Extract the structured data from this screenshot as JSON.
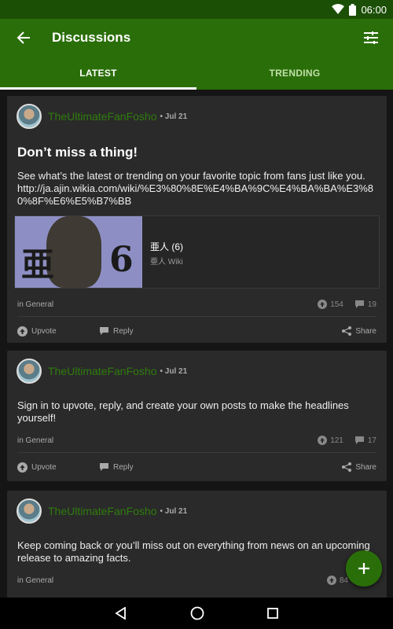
{
  "status": {
    "time": "06:00"
  },
  "appbar": {
    "title": "Discussions"
  },
  "tabs": [
    {
      "label": "LATEST"
    },
    {
      "label": "TRENDING"
    }
  ],
  "posts": [
    {
      "author": "TheUltimateFanFosho",
      "date": "• Jul 21",
      "title": "Don’t miss a thing!",
      "body": "See what’s the latest or trending on your favorite topic from fans just like you. http://ja.ajin.wikia.com/wiki/%E3%80%8E%E4%BA%9C%E4%BA%BA%E3%80%8F%E6%E5%B7%BB",
      "preview": {
        "title": "亜人 (6)",
        "site": "亜人 Wiki",
        "thumb_glyph_1": "亜",
        "thumb_glyph_2": "6"
      },
      "category": "in General",
      "upvotes": "154",
      "replies": "19",
      "actions": {
        "upvote": "Upvote",
        "reply": "Reply",
        "share": "Share"
      }
    },
    {
      "author": "TheUltimateFanFosho",
      "date": "• Jul 21",
      "body": "Sign in to upvote, reply, and create your own posts to make the headlines yourself!",
      "category": "in General",
      "upvotes": "121",
      "replies": "17",
      "actions": {
        "upvote": "Upvote",
        "reply": "Reply",
        "share": "Share"
      }
    },
    {
      "author": "TheUltimateFanFosho",
      "date": "• Jul 21",
      "body": "Keep coming back or you’ll miss out on everything from news on an upcoming release to amazing facts.",
      "category": "in General",
      "upvotes": "84"
    }
  ],
  "colors": {
    "primary": "#2a6e09",
    "status_bar": "#1c4f06",
    "author": "#2f7c0d",
    "card": "#2a2a2a",
    "background": "#151515"
  },
  "icons": {
    "status": [
      "wifi-icon",
      "battery-icon"
    ],
    "appbar": [
      "back-arrow-icon",
      "filter-sliders-icon"
    ],
    "post": [
      "upvote-icon",
      "reply-bubble-icon",
      "share-icon"
    ],
    "fab": "plus-icon",
    "nav": [
      "back-triangle-icon",
      "home-circle-icon",
      "recents-square-icon"
    ]
  }
}
